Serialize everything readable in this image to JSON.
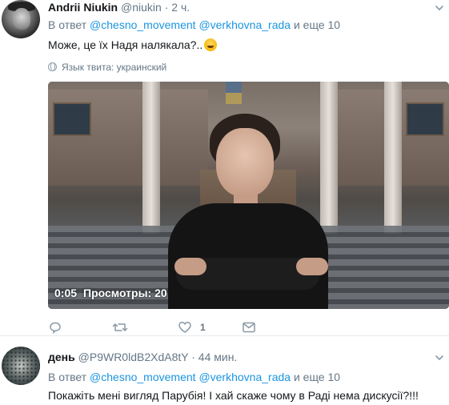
{
  "tweets": [
    {
      "name": "Andrii Niukin",
      "handle": "@niukin",
      "separator": "·",
      "time": "2 ч.",
      "reply_prefix": "В ответ",
      "mention1": "@chesno_movement",
      "mention2": "@verkhovna_rada",
      "reply_suffix": "и еще 10",
      "text": "Може, це їх Надя налякала?..",
      "emoji": "rolling-on-floor-laughing-emoji",
      "language_label": "Язык твита: украинский",
      "video": {
        "time": "0:05",
        "views": "Просмотры: 20"
      },
      "actions": {
        "like_count": "1"
      }
    },
    {
      "name": "день",
      "handle": "@P9WR0ldB2XdA8tY",
      "separator": "·",
      "time": "44 мин.",
      "reply_prefix": "В ответ",
      "mention1": "@chesno_movement",
      "mention2": "@verkhovna_rada",
      "reply_suffix": "и еще 10",
      "text": "Покажіть мені вигляд Парубія! І хай скаже чому в Раді нема дискусії?!!!"
    }
  ],
  "colors": {
    "link": "#1b95e0",
    "secondary": "#657786",
    "icon": "#8899a6"
  }
}
